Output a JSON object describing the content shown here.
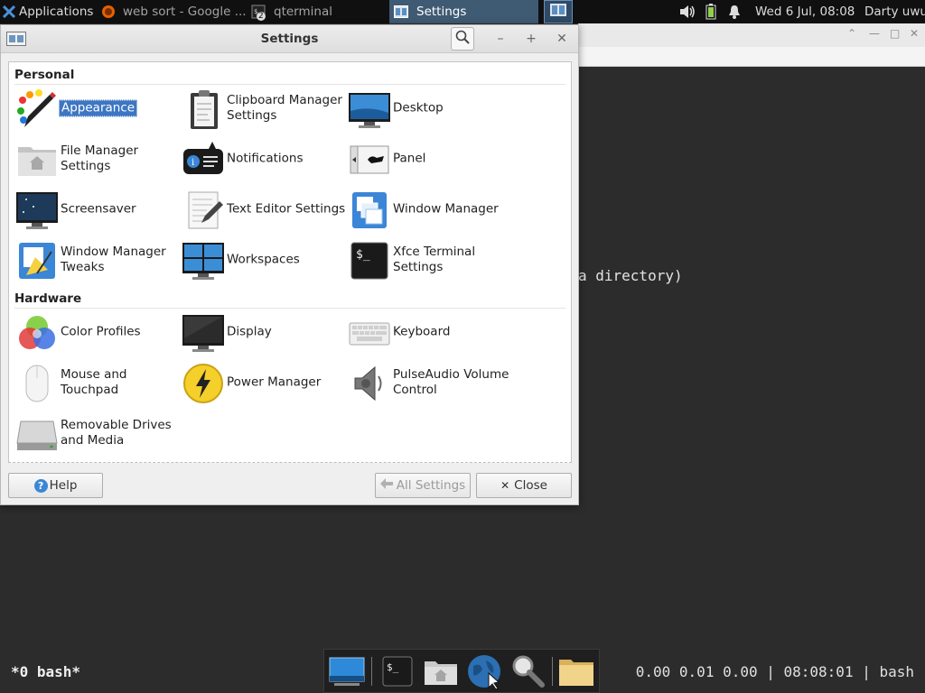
{
  "top_panel": {
    "applications": "Applications",
    "tasks": [
      {
        "label": "web sort - Google ..."
      },
      {
        "label": "qterminal",
        "badge": "2"
      },
      {
        "label": "Settings"
      }
    ],
    "clock": "Wed  6 Jul, 08:08",
    "user": "Darty uwu"
  },
  "terminal": {
    "output_line": "a directory)",
    "tmux_left": "*0 bash*",
    "tmux_right": "0.00 0.01 0.00 | 08:08:01 | bash"
  },
  "settings_window": {
    "title": "Settings",
    "sections": [
      {
        "heading": "Personal",
        "items": [
          {
            "label": "Appearance",
            "icon": "appearance-icon",
            "selected": true
          },
          {
            "label": "Clipboard Manager Settings",
            "icon": "clipboard-icon"
          },
          {
            "label": "Desktop",
            "icon": "desktop-icon"
          },
          {
            "label": "File Manager Settings",
            "icon": "file-manager-icon"
          },
          {
            "label": "Notifications",
            "icon": "notifications-icon"
          },
          {
            "label": "Panel",
            "icon": "panel-icon"
          },
          {
            "label": "Screensaver",
            "icon": "screensaver-icon"
          },
          {
            "label": "Text Editor Settings",
            "icon": "text-editor-icon"
          },
          {
            "label": "Window Manager",
            "icon": "window-manager-icon"
          },
          {
            "label": "Window Manager Tweaks",
            "icon": "window-manager-tweaks-icon"
          },
          {
            "label": "Workspaces",
            "icon": "workspaces-icon"
          },
          {
            "label": "Xfce Terminal Settings",
            "icon": "terminal-icon"
          }
        ]
      },
      {
        "heading": "Hardware",
        "items": [
          {
            "label": "Color Profiles",
            "icon": "color-profiles-icon"
          },
          {
            "label": "Display",
            "icon": "display-icon"
          },
          {
            "label": "Keyboard",
            "icon": "keyboard-icon"
          },
          {
            "label": "Mouse and Touchpad",
            "icon": "mouse-icon"
          },
          {
            "label": "Power Manager",
            "icon": "power-icon"
          },
          {
            "label": "PulseAudio Volume Control",
            "icon": "speaker-icon"
          },
          {
            "label": "Removable Drives and Media",
            "icon": "drive-icon"
          }
        ]
      }
    ],
    "buttons": {
      "help": "Help",
      "all_settings": "All Settings",
      "close": "Close"
    }
  },
  "colors": {
    "selection": "#3d76c2",
    "panel_bg": "#101010",
    "terminal_bg": "#2c2c2c"
  }
}
